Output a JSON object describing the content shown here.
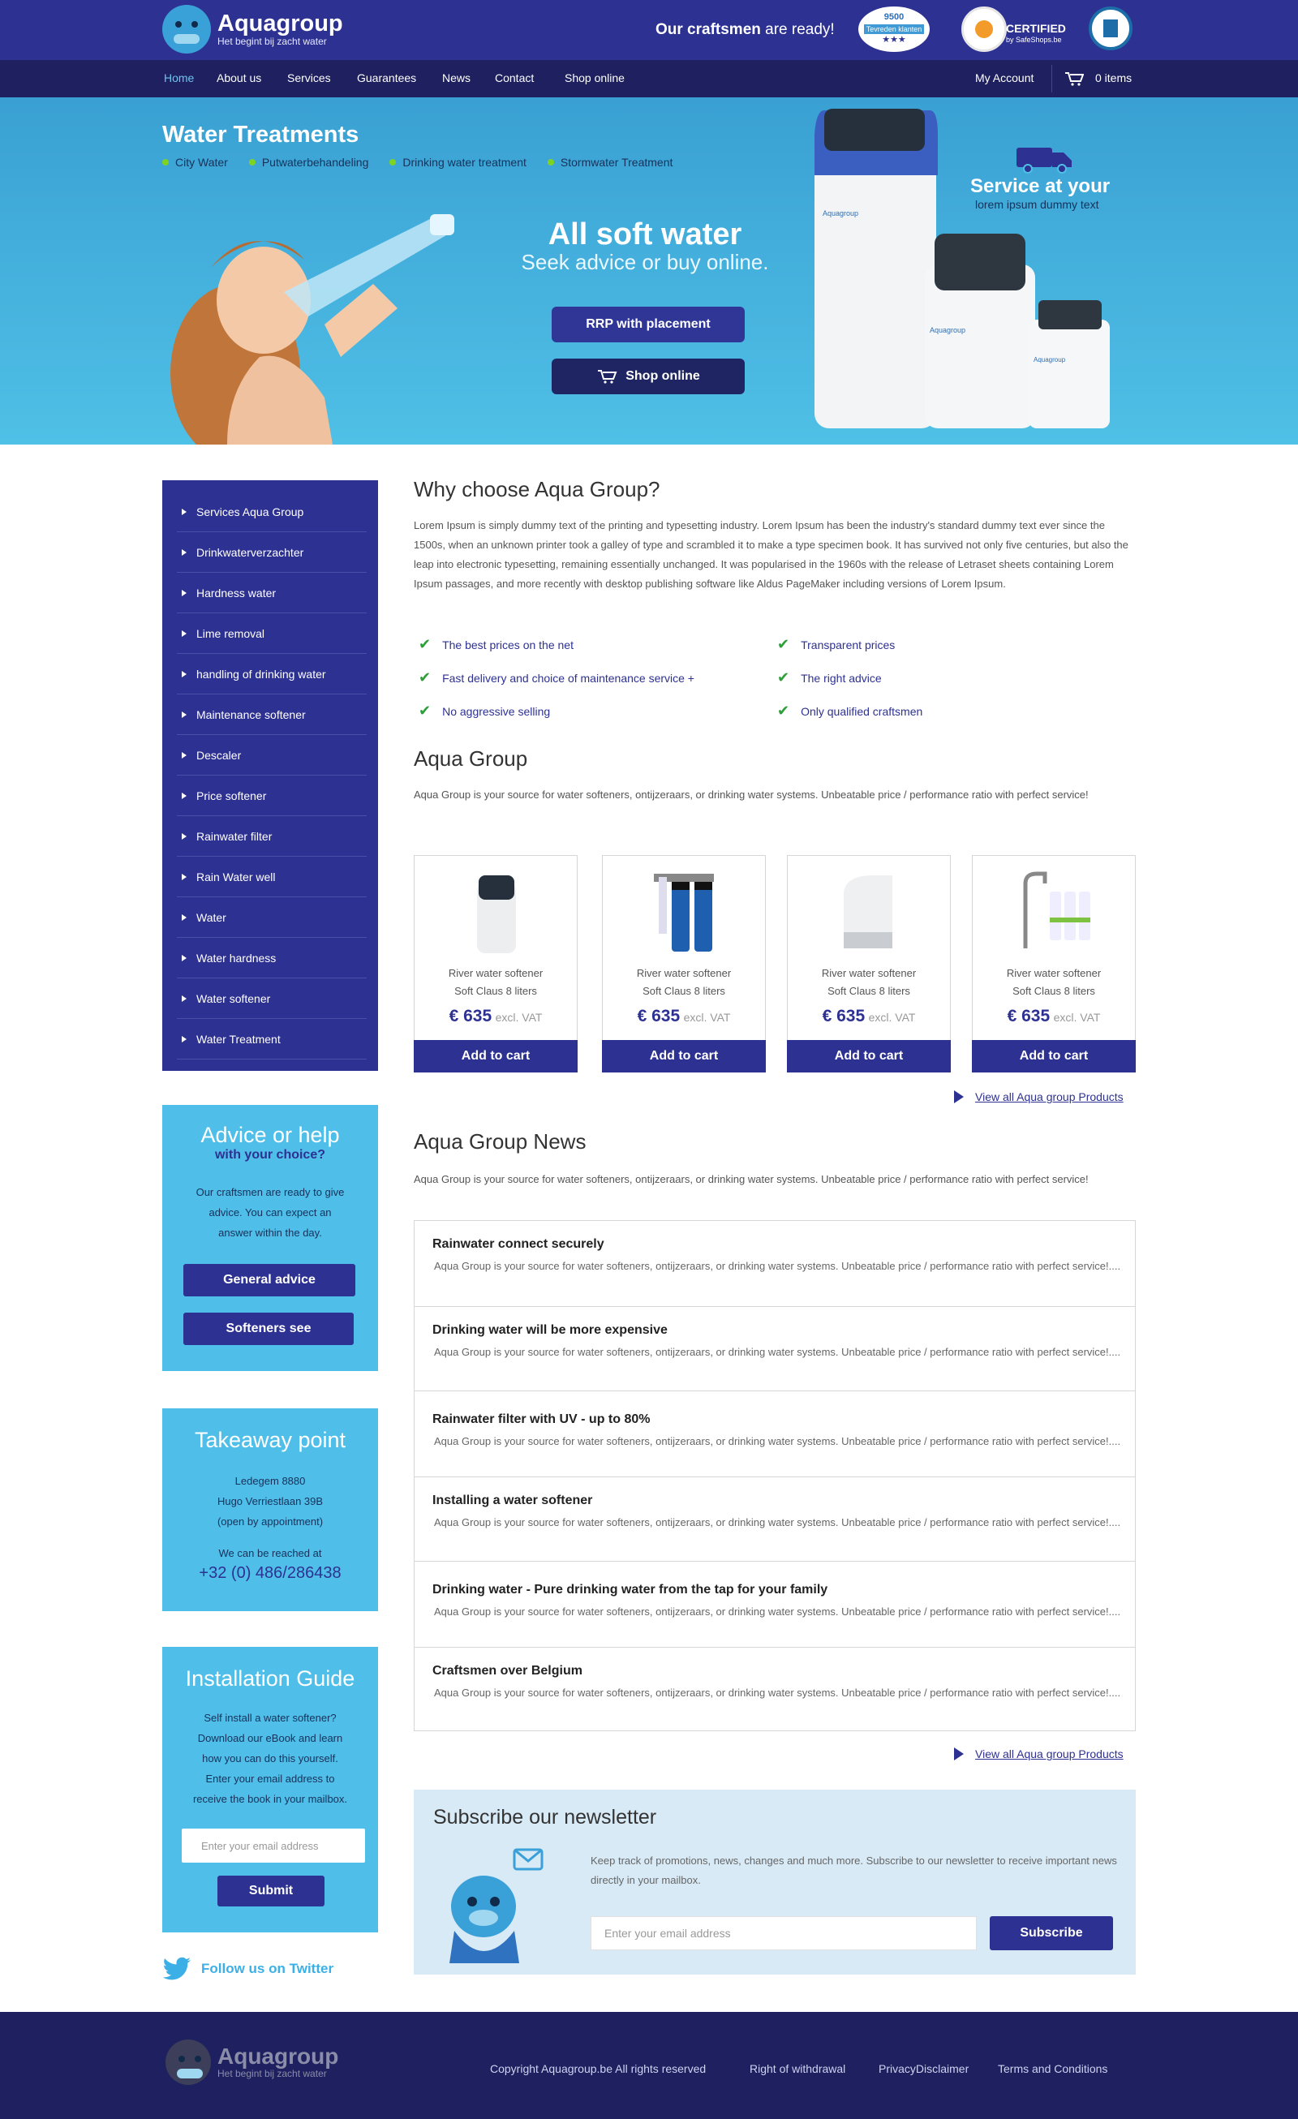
{
  "header": {
    "brand": "Aquagroup",
    "tagline": "Het begint bij zacht water",
    "craft_bold": "Our craftsmen",
    "craft_rest": " are ready!",
    "badge_count": "9500",
    "badge_label": "Tevreden klanten",
    "cert_label": "CERTIFIED",
    "cert_sub": "by SafeShops.be"
  },
  "nav": {
    "items": [
      "Home",
      "About us",
      "Services",
      "Guarantees",
      "News",
      "Contact",
      "Shop online"
    ],
    "account": "My Account",
    "cart": "0 items"
  },
  "hero": {
    "title": "Water Treatments",
    "categories": [
      "City Water",
      "Putwaterbehandeling",
      "Drinking water treatment",
      "Stormwater Treatment"
    ],
    "headline": "All soft water",
    "subline": "Seek advice or buy online.",
    "btn_rrp": "RRP with placement",
    "btn_shop": "Shop online",
    "service_title": "Service at your",
    "service_sub": "lorem ipsum dummy text"
  },
  "sidebar": {
    "menu": [
      "Services Aqua Group",
      "Drinkwaterverzachter",
      "Hardness water",
      "Lime removal",
      "handling of drinking water",
      "Maintenance softener",
      "Descaler",
      "Price softener",
      "Rainwater filter",
      "Rain Water well",
      "Water",
      "Water hardness",
      "Water softener",
      "Water Treatment"
    ],
    "advice": {
      "title": "Advice or help",
      "sub": "with your choice?",
      "text": "Our craftsmen are ready to give advice. You can expect an answer within the day.",
      "btn1": "General advice",
      "btn2": "Softeners see"
    },
    "takeaway": {
      "title": "Takeaway point",
      "line1": "Ledegem 8880",
      "line2": "Hugo Verriestlaan 39B",
      "line3": "(open by appointment)",
      "line4": "We can be reached at",
      "phone": "+32 (0) 486/286438"
    },
    "guide": {
      "title": "Installation Guide",
      "text": "Self install a water softener? Download our eBook and learn how you can do this yourself. Enter your email address to receive the book in your mailbox.",
      "placeholder": "Enter your email address",
      "submit": "Submit"
    },
    "twitter": "Follow us on Twitter"
  },
  "why": {
    "title": "Why choose Aqua Group?",
    "text": "Lorem Ipsum is simply dummy text of the printing and typesetting industry. Lorem Ipsum has been the industry's standard dummy text ever since the 1500s, when an unknown printer took a galley of type and scrambled it to make a type specimen book. It has survived not only five centuries, but also the leap into electronic typesetting, remaining essentially unchanged. It was popularised in the 1960s with the release of Letraset sheets containing Lorem Ipsum passages, and more recently with desktop publishing software like Aldus PageMaker including versions of Lorem Ipsum.",
    "checks": [
      "The best prices on the net",
      "Fast delivery and choice of maintenance service +",
      "No aggressive selling",
      "Transparent prices",
      "The right advice",
      "Only qualified craftsmen"
    ]
  },
  "group": {
    "title": "Aqua Group",
    "text": "Aqua Group is your source for water softeners, ontijzeraars, or drinking water systems. Unbeatable price / performance ratio with perfect service!",
    "products": [
      {
        "name": "River water softener",
        "sub": "Soft Claus 8 liters",
        "price": "€ 635",
        "vat": "excl. VAT",
        "cart": "Add to cart"
      },
      {
        "name": "River water softener",
        "sub": "Soft Claus 8 liters",
        "price": "€ 635",
        "vat": "excl. VAT",
        "cart": "Add to cart"
      },
      {
        "name": "River water softener",
        "sub": "Soft Claus 8 liters",
        "price": "€ 635",
        "vat": "excl. VAT",
        "cart": "Add to cart"
      },
      {
        "name": "River water softener",
        "sub": "Soft Claus 8 liters",
        "price": "€ 635",
        "vat": "excl. VAT",
        "cart": "Add to cart"
      }
    ],
    "viewall": "View all Aqua group Products"
  },
  "news": {
    "title": "Aqua Group News",
    "text": "Aqua Group is your source for water softeners, ontijzeraars, or drinking water systems. Unbeatable price / performance ratio with perfect service!",
    "items": [
      {
        "title": "Rainwater connect securely",
        "desc": "Aqua Group is your source for water softeners, ontijzeraars, or drinking water systems. Unbeatable price / performance ratio with perfect service!...."
      },
      {
        "title": "Drinking water will be more expensive",
        "desc": "Aqua Group is your source for water softeners, ontijzeraars, or drinking water systems. Unbeatable price / performance ratio with perfect service!...."
      },
      {
        "title": "Rainwater filter with UV - up to 80%",
        "desc": "Aqua Group is your source for water softeners, ontijzeraars, or drinking water systems. Unbeatable price / performance ratio with perfect service!...."
      },
      {
        "title": "Installing a water softener",
        "desc": "Aqua Group is your source for water softeners, ontijzeraars, or drinking water systems. Unbeatable price / performance ratio with perfect service!...."
      },
      {
        "title": "Drinking water - Pure drinking water from the tap for your family",
        "desc": "Aqua Group is your source for water softeners, ontijzeraars, or drinking water systems. Unbeatable price / performance ratio with perfect service!...."
      },
      {
        "title": "Craftsmen over Belgium",
        "desc": "Aqua Group is your source for water softeners, ontijzeraars, or drinking water systems. Unbeatable price / performance ratio with perfect service!...."
      }
    ],
    "viewall": "View all Aqua group Products"
  },
  "newsletter": {
    "title": "Subscribe our newsletter",
    "text": "Keep track of promotions, news, changes and much more. Subscribe to our newsletter to receive important news directly in your mailbox.",
    "placeholder": "Enter your email address",
    "btn": "Subscribe"
  },
  "footer": {
    "brand": "Aquagroup",
    "tagline": "Het begint bij zacht water",
    "links": [
      "Copyright Aquagroup.be All rights reserved",
      "Right of withdrawal",
      "PrivacyDisclaimer",
      "Terms and Conditions"
    ]
  }
}
